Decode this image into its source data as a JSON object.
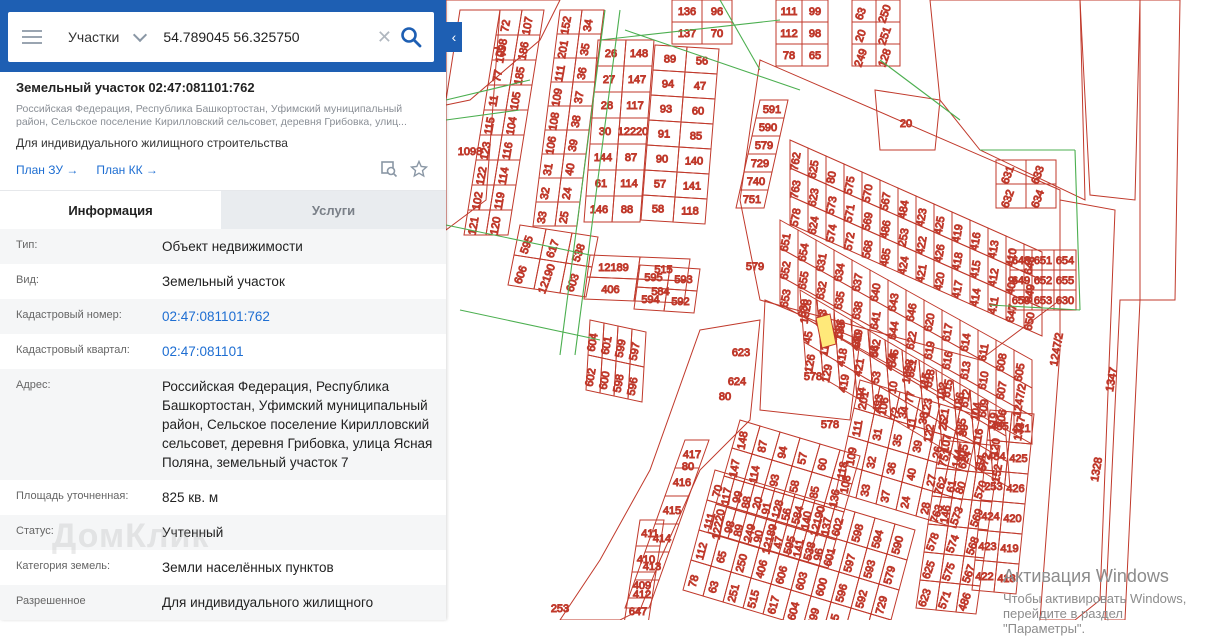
{
  "search": {
    "layer": "Участки",
    "query": "54.789045 56.325750"
  },
  "parcel": {
    "title": "Земельный участок 02:47:081101:762",
    "address_short": "Российская Федерация, Республика Башкортостан, Уфимский муниципальный район, Сельское поселение Кирилловский сельсовет, деревня Грибовка, улиц...",
    "purpose": "Для индивидуального жилищного строительства",
    "plan_zu": "План ЗУ →",
    "plan_kk": "План КК →"
  },
  "tabs": {
    "info": "Информация",
    "services": "Услуги"
  },
  "rows": [
    {
      "k": "Тип:",
      "v": "Объект недвижимости"
    },
    {
      "k": "Вид:",
      "v": "Земельный участок"
    },
    {
      "k": "Кадастровый номер:",
      "v": "02:47:081101:762",
      "link": true
    },
    {
      "k": "Кадастровый квартал:",
      "v": "02:47:081101",
      "link": true
    },
    {
      "k": "Адрес:",
      "v": "Российская Федерация, Республика Башкортостан, Уфимский муниципальный район, Сельское поселение Кирилловский сельсовет, деревня Грибовка, улица Ясная Поляна, земельный участок 7"
    },
    {
      "k": "Площадь уточненная:",
      "v": "825 кв. м"
    },
    {
      "k": "Статус:",
      "v": "Учтенный"
    },
    {
      "k": "Категория земель:",
      "v": "Земли населённых пунктов"
    },
    {
      "k": "Разрешенное",
      "v": "Для индивидуального жилищного"
    }
  ],
  "watermark": "ДомКлик",
  "activation": {
    "title": "Активация Windows",
    "subtitle": "Чтобы активировать Windows, перейдите в раздел \"Параметры\"."
  },
  "map": {
    "highlight_color": "#ffe97a",
    "boundary_color": "#c0392b",
    "green_color": "#4caf50",
    "labels": [
      "72",
      "1098",
      "77",
      "11",
      "115",
      "123",
      "122",
      "102",
      "121",
      "107",
      "186",
      "185",
      "105",
      "104",
      "116",
      "114",
      "119",
      "120",
      "152",
      "201",
      "111",
      "109",
      "108",
      "106",
      "31",
      "32",
      "33",
      "34",
      "35",
      "36",
      "37",
      "38",
      "39",
      "40",
      "24",
      "25",
      "26",
      "27",
      "28",
      "30",
      "144",
      "61",
      "146",
      "148",
      "147",
      "117",
      "12220",
      "87",
      "114",
      "88",
      "89",
      "94",
      "93",
      "91",
      "90",
      "57",
      "58",
      "56",
      "47",
      "60",
      "85",
      "140",
      "141",
      "118",
      "136",
      "137",
      "96",
      "70",
      "111",
      "112",
      "78",
      "99",
      "98",
      "65",
      "63",
      "20",
      "249",
      "250",
      "251",
      "128",
      "12189",
      "406",
      "515",
      "584",
      "595",
      "606",
      "617",
      "12190",
      "538",
      "603",
      "604",
      "602",
      "601",
      "600",
      "599",
      "598",
      "597",
      "596",
      "595",
      "594",
      "593",
      "592",
      "591",
      "590",
      "579",
      "729",
      "740",
      "751",
      "762",
      "763",
      "578",
      "625",
      "623",
      "624",
      "80",
      "573",
      "574",
      "575",
      "571",
      "572",
      "570",
      "569",
      "568",
      "567",
      "486",
      "485",
      "484",
      "253",
      "424",
      "423",
      "422",
      "421",
      "425",
      "426",
      "420",
      "419",
      "418",
      "417",
      "416",
      "415",
      "414",
      "413",
      "412",
      "411",
      "410",
      "409",
      "647",
      "648",
      "649",
      "650",
      "651",
      "652",
      "653",
      "654",
      "655",
      "630",
      "631",
      "632",
      "633",
      "634",
      "635",
      "636",
      "637",
      "638",
      "639",
      "640",
      "641",
      "642",
      "643",
      "644",
      "645",
      "646",
      "622",
      "621",
      "620",
      "619",
      "618",
      "617",
      "616",
      "615",
      "614",
      "613",
      "612",
      "611",
      "610",
      "609",
      "608",
      "607",
      "606",
      "605",
      "1247/2",
      "1347",
      "1328",
      "45",
      "126",
      "125",
      "115",
      "129",
      "130",
      "418",
      "419",
      "440",
      "421",
      "94",
      "56",
      "53",
      "493",
      "471",
      "10"
    ]
  }
}
